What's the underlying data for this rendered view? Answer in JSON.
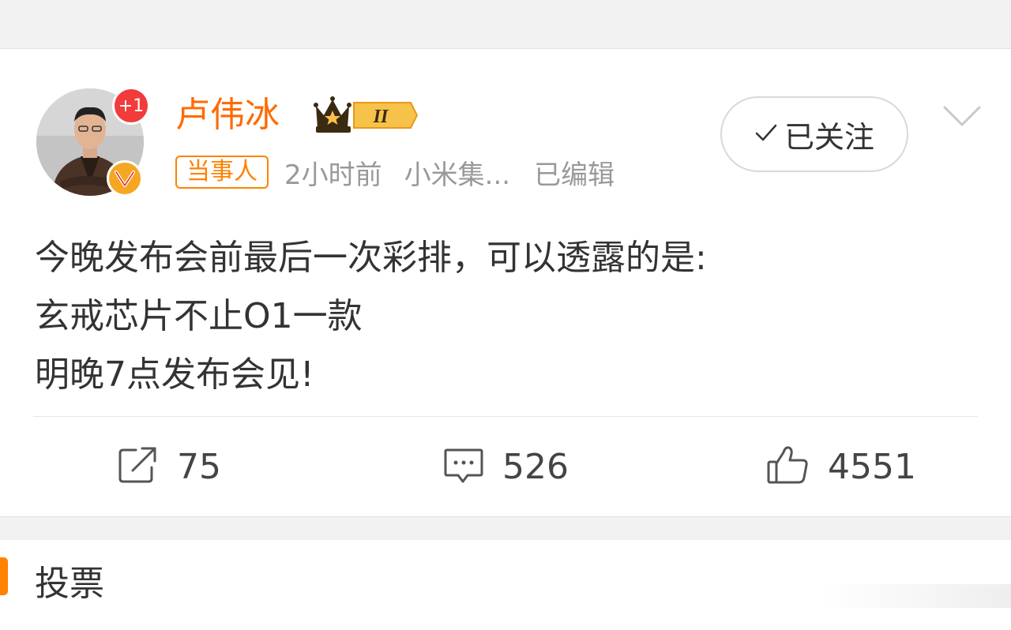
{
  "post": {
    "user": {
      "name": "卢伟冰",
      "level_badge": "II",
      "new_count_badge": "+1",
      "verified_mark": "V"
    },
    "meta": {
      "tag": "当事人",
      "time": "2小时前",
      "source": "小米集...",
      "edited": "已编辑"
    },
    "follow_button": {
      "label": "已关注",
      "icon": "checkmark-icon"
    },
    "more_icon": "chevron-down-icon",
    "text_lines": [
      "今晚发布会前最后一次彩排，可以透露的是:",
      "玄戒芯片不止O1一款",
      "明晚7点发布会见!"
    ],
    "actions": {
      "repost": {
        "count": "75",
        "icon": "repost-icon"
      },
      "comment": {
        "count": "526",
        "icon": "comment-icon"
      },
      "like": {
        "count": "4551",
        "icon": "thumbs-up-icon"
      }
    }
  },
  "vote_section": {
    "title": "投票"
  },
  "colors": {
    "accent_orange": "#ff6a00",
    "tag_orange": "#ff8200",
    "badge_red": "#f23b3b",
    "verified_gold": "#f5a623",
    "muted_text": "#999999"
  }
}
